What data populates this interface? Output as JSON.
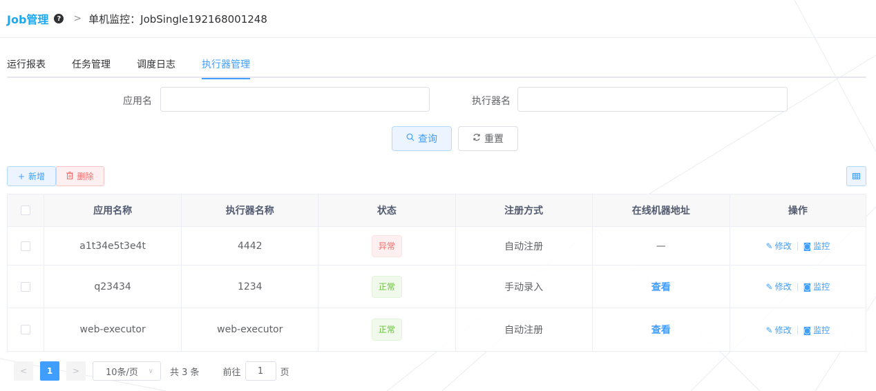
{
  "header": {
    "brand": "Job管理",
    "help_icon": "question-circle-icon",
    "separator": ">",
    "breadcrumb": "单机监控：JobSingle192168001248"
  },
  "tabs": [
    {
      "label": "运行报表",
      "active": false
    },
    {
      "label": "任务管理",
      "active": false
    },
    {
      "label": "调度日志",
      "active": false
    },
    {
      "label": "执行器管理",
      "active": true
    }
  ],
  "search": {
    "app_name_label": "应用名",
    "app_name_value": "",
    "executor_name_label": "执行器名",
    "executor_name_value": "",
    "query_label": "查询",
    "reset_label": "重置"
  },
  "toolbar": {
    "add_label": "新增",
    "delete_label": "删除",
    "columns_icon": "table-columns-icon"
  },
  "table": {
    "columns": [
      "应用名称",
      "执行器名称",
      "状态",
      "注册方式",
      "在线机器地址",
      "操作"
    ],
    "rows": [
      {
        "app": "a1t34e5t3e4t",
        "executor": "4442",
        "status": "异常",
        "status_type": "error",
        "reg": "自动注册",
        "address": "—",
        "address_is_link": false
      },
      {
        "app": "q23434",
        "executor": "1234",
        "status": "正常",
        "status_type": "ok",
        "reg": "手动录入",
        "address": "查看",
        "address_is_link": true
      },
      {
        "app": "web-executor",
        "executor": "web-executor",
        "status": "正常",
        "status_type": "ok",
        "reg": "自动注册",
        "address": "查看",
        "address_is_link": true
      }
    ],
    "edit_label": "修改",
    "monitor_label": "监控"
  },
  "pagination": {
    "current_page": "1",
    "page_size": "10条/页",
    "total": "共 3 条",
    "goto_label": "前往",
    "goto_value": "1",
    "page_suffix": "页"
  },
  "colors": {
    "primary": "#409eff",
    "brand": "#1aa8f0",
    "danger": "#f56c6c",
    "success": "#67c23a"
  }
}
